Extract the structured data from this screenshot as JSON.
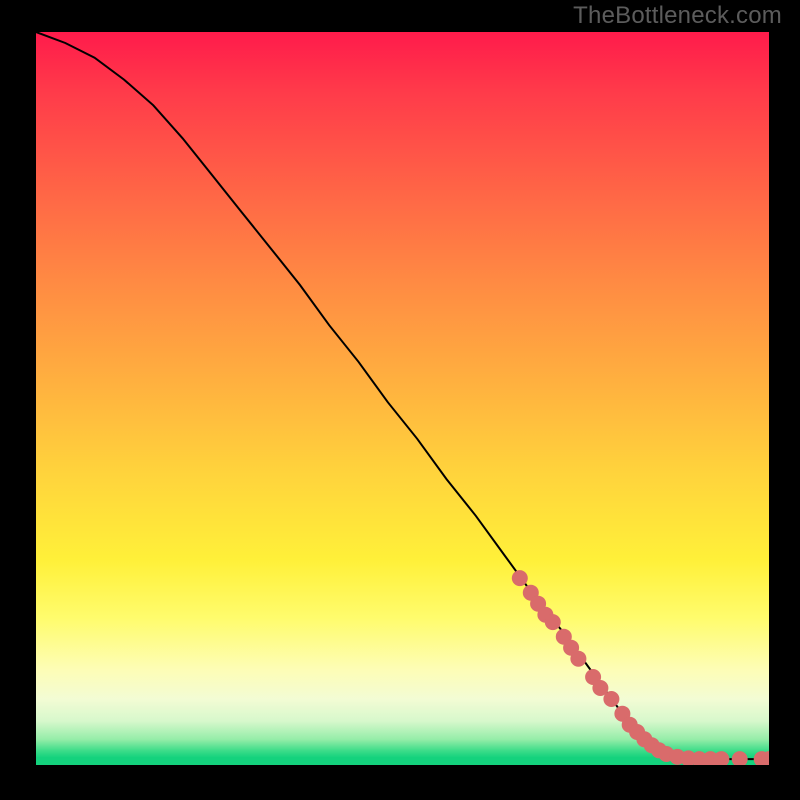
{
  "watermark": "TheBottleneck.com",
  "chart_data": {
    "type": "line",
    "title": "",
    "xlabel": "",
    "ylabel": "",
    "xlim": [
      0,
      100
    ],
    "ylim": [
      0,
      100
    ],
    "grid": false,
    "curve": {
      "name": "bottleneck-curve",
      "color": "#000000",
      "x": [
        0,
        4,
        8,
        12,
        16,
        20,
        24,
        28,
        32,
        36,
        40,
        44,
        48,
        52,
        56,
        60,
        64,
        68,
        72,
        76,
        80,
        83,
        85,
        87,
        89,
        91,
        93,
        95,
        97,
        99,
        100
      ],
      "y": [
        100,
        98.5,
        96.5,
        93.5,
        90,
        85.5,
        80.5,
        75.5,
        70.5,
        65.5,
        60,
        55,
        49.5,
        44.5,
        39,
        34,
        28.5,
        23,
        18,
        12.5,
        7,
        3.5,
        2,
        1.2,
        0.9,
        0.8,
        0.8,
        0.8,
        0.8,
        0.8,
        0.8
      ]
    },
    "markers": {
      "name": "highlight-points",
      "color": "#d96b6b",
      "radius": 8,
      "points": [
        {
          "x": 66,
          "y": 25.5
        },
        {
          "x": 67.5,
          "y": 23.5
        },
        {
          "x": 68.5,
          "y": 22
        },
        {
          "x": 69.5,
          "y": 20.5
        },
        {
          "x": 70.5,
          "y": 19.5
        },
        {
          "x": 72,
          "y": 17.5
        },
        {
          "x": 73,
          "y": 16
        },
        {
          "x": 74,
          "y": 14.5
        },
        {
          "x": 76,
          "y": 12
        },
        {
          "x": 77,
          "y": 10.5
        },
        {
          "x": 78.5,
          "y": 9
        },
        {
          "x": 80,
          "y": 7
        },
        {
          "x": 81,
          "y": 5.5
        },
        {
          "x": 82,
          "y": 4.5
        },
        {
          "x": 83,
          "y": 3.5
        },
        {
          "x": 84,
          "y": 2.7
        },
        {
          "x": 85,
          "y": 2
        },
        {
          "x": 86,
          "y": 1.5
        },
        {
          "x": 87.5,
          "y": 1.1
        },
        {
          "x": 89,
          "y": 0.9
        },
        {
          "x": 90.5,
          "y": 0.8
        },
        {
          "x": 92,
          "y": 0.8
        },
        {
          "x": 93.5,
          "y": 0.8
        },
        {
          "x": 96,
          "y": 0.8
        },
        {
          "x": 99,
          "y": 0.8
        },
        {
          "x": 100,
          "y": 0.8
        }
      ]
    }
  }
}
